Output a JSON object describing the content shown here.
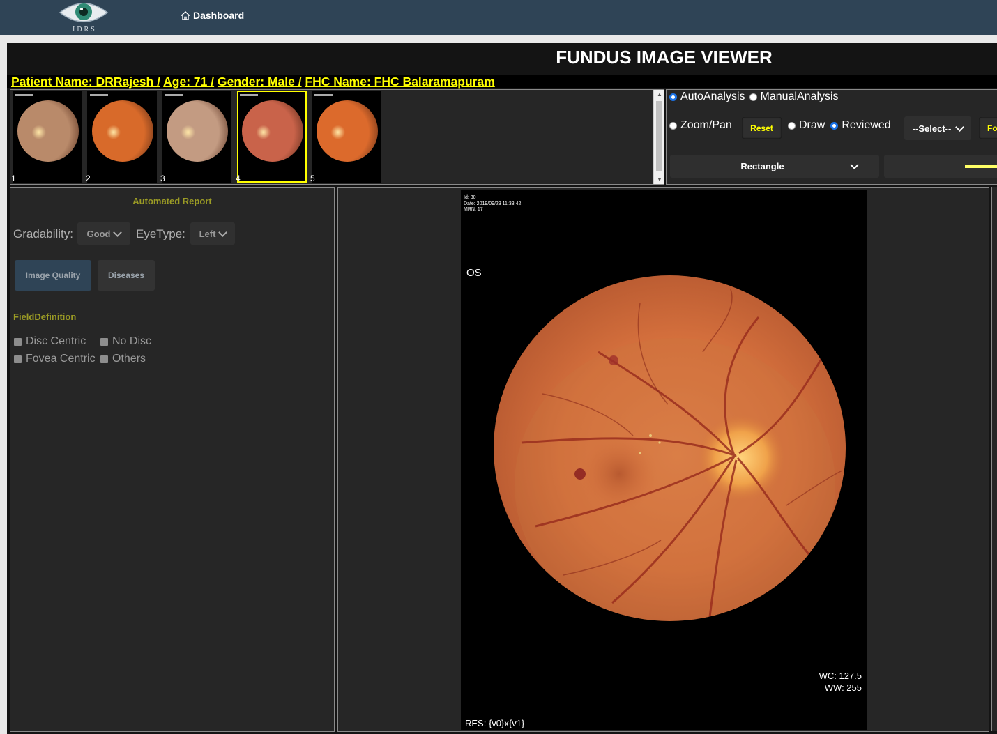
{
  "nav": {
    "logo_text": "IDRS",
    "dashboard_label": "Dashboard"
  },
  "viewer": {
    "title": "FUNDUS IMAGE VIEWER",
    "patient": {
      "name": "Patient Name: DRRajesh /",
      "age": "Age: 71 /",
      "gender": "Gender: Male /",
      "fhc": "FHC Name: FHC Balaramapuram"
    }
  },
  "thumbnails": [
    {
      "number": "1",
      "selected": false,
      "tone": "#b98a6a"
    },
    {
      "number": "2",
      "selected": false,
      "tone": "#d86a2a"
    },
    {
      "number": "3",
      "selected": false,
      "tone": "#c39b82"
    },
    {
      "number": "4",
      "selected": true,
      "tone": "#c9634a"
    },
    {
      "number": "5",
      "selected": false,
      "tone": "#dc6a2c"
    }
  ],
  "controls": {
    "auto_analysis": "AutoAnalysis",
    "manual_analysis": "ManualAnalysis",
    "analysis_selected": "AutoAnalysis",
    "zoom_pan": "Zoom/Pan",
    "reset": "Reset",
    "draw": "Draw",
    "reviewed": "Reviewed",
    "mode_selected": "Reviewed",
    "select_placeholder": "--Select--",
    "cut_button": "Fo",
    "shape": "Rectangle",
    "line_color": "#ffff66"
  },
  "report": {
    "title": "Automated Report",
    "gradability_label": "Gradability:",
    "gradability_value": "Good",
    "eyetype_label": "EyeType:",
    "eyetype_value": "Left",
    "tab_image_quality": "Image Quality",
    "tab_diseases": "Diseases",
    "field_definition_title": "FieldDefinition",
    "fields": [
      "Disc Centric",
      "No Disc",
      "Fovea Centric",
      "Others"
    ]
  },
  "image": {
    "meta_id": "Id: 30",
    "meta_date": "Date: 2019/09/23 11:33:42",
    "meta_mrn": "MRN: 17",
    "eye_label": "OS",
    "wc": "WC: 127.5",
    "ww": "WW: 255",
    "res": "RES: {v0}x{v1}"
  }
}
